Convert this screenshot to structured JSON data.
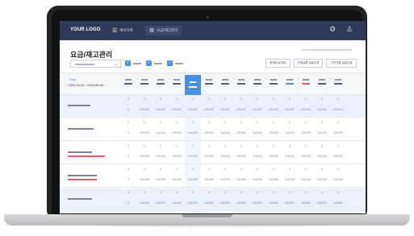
{
  "header": {
    "logo": "YOUR LOGO",
    "nav": [
      {
        "label": "예약목록",
        "icon": "menu-icon"
      },
      {
        "label": "요금/재고관리",
        "icon": "sliders-icon"
      }
    ],
    "right_icons": [
      "gear-icon",
      "user-icon"
    ]
  },
  "page": {
    "title": "요금/재고관리"
  },
  "filters": {
    "select_icon": "chevron-down-icon",
    "checkboxes": [
      {
        "checked": true
      },
      {
        "checked": true
      },
      {
        "checked": true
      }
    ]
  },
  "actions": [
    "판매요금/재고",
    "전체날짜 일괄수정",
    "기간지정 일괄수정"
  ],
  "calendar": {
    "today_label": "Today",
    "date_range": "‹ 2020.04.20 - 2020.05.03 ›",
    "day_count": 14,
    "selected_day_index": 4,
    "blue_day_index": 10,
    "red_day_index": 11
  },
  "rows": [
    {
      "highlight": true,
      "top": [
        "0",
        "2",
        "2",
        "2",
        "1",
        "2",
        "2",
        "2",
        "2",
        "2",
        "2",
        "2",
        "2",
        "2"
      ],
      "bottom": [
        "0",
        "240,000",
        "240,000",
        "240,000",
        "240,000",
        "240,000",
        "240,000",
        "240,000",
        "240,000",
        "240,000",
        "240,000",
        "240,000",
        "240,000",
        "240,000"
      ]
    },
    {
      "highlight": false,
      "top": [
        "0",
        "2",
        "2",
        "2",
        "2",
        "2",
        "2",
        "2",
        "2",
        "2",
        "2",
        "2",
        "2",
        "2"
      ],
      "bottom": [
        "0",
        "240,000",
        "240,000",
        "240,000",
        "240,000",
        "240,000",
        "240,000",
        "240,000",
        "240,000",
        "240,000",
        "240,000",
        "240,000",
        "240,000",
        "240,000"
      ]
    },
    {
      "highlight": false,
      "top": [
        "0",
        "2",
        "2",
        "2",
        "2",
        "2",
        "2",
        "2",
        "2",
        "2",
        "2",
        "2",
        "2",
        "2"
      ],
      "bottom": [
        "0",
        "240,000",
        "240,000",
        "240,000",
        "240,000",
        "240,000",
        "240,000",
        "240,000",
        "240,000",
        "240,000",
        "240,000",
        "240,000",
        "240,000",
        "240,000"
      ]
    },
    {
      "highlight": false,
      "top": [
        "0",
        "2",
        "2",
        "2",
        "2",
        "2",
        "2",
        "2",
        "2",
        "2",
        "2",
        "2",
        "2",
        "2"
      ],
      "bottom": [
        "0",
        "240,000",
        "240,000",
        "240,000",
        "240,000",
        "240,000",
        "240,000",
        "240,000",
        "240,000",
        "240,000",
        "240,000",
        "240,000",
        "240,000",
        "240,000"
      ]
    },
    {
      "highlight": true,
      "top": [
        "0",
        "2",
        "2",
        "2",
        "2",
        "2",
        "2",
        "2",
        "2",
        "2",
        "2",
        "2",
        "2",
        "2"
      ],
      "bottom": [
        "0",
        "240,000",
        "240,000",
        "240,000",
        "240,000",
        "240,000",
        "240,000",
        "240,000",
        "240,000",
        "240,000",
        "240,000",
        "240,000",
        "240,000",
        "240,000"
      ]
    }
  ]
}
